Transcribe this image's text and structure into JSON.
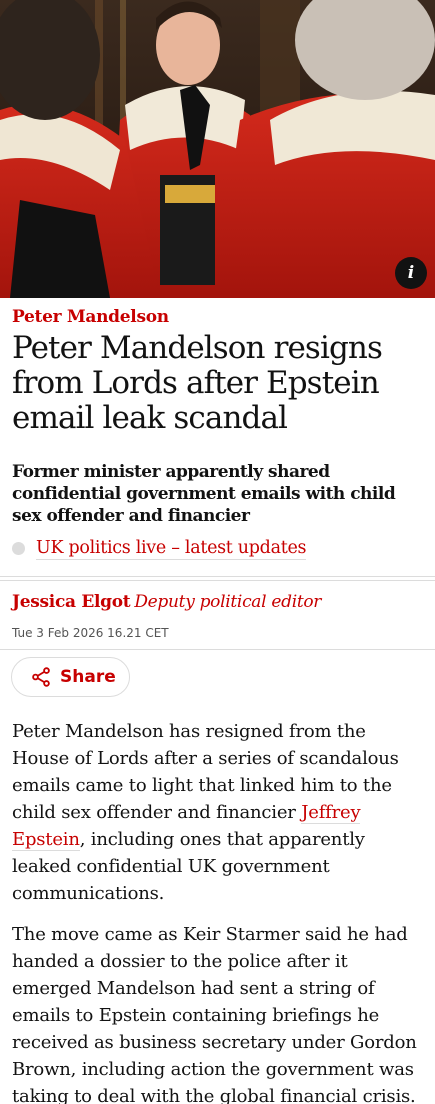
{
  "hero": {
    "info_label": "i"
  },
  "article": {
    "kicker": "Peter Mandelson",
    "headline": "Peter Mandelson resigns from Lords after Epstein email leak scandal",
    "standfirst": "Former minister apparently shared confidential government emails with child sex offender and financier",
    "live_link": "UK politics live – latest updates",
    "byline": {
      "name": "Jessica Elgot",
      "role": "Deputy political editor"
    },
    "dateline": "Tue 3 Feb 2026 16.21 CET",
    "share_label": "Share",
    "body": {
      "p1_before": "Peter Mandelson has resigned from the House of Lords after a series of scandalous emails came to light that linked him to the child sex offender and financier ",
      "p1_link": "Jeffrey Epstein",
      "p1_after": ", including ones that apparently leaked confidential UK government communications.",
      "p2": "The move came as Keir Starmer said he had handed a dossier to the police after it emerged Mandelson had sent a string of emails to Epstein containing briefings he received as business secretary under Gordon Brown, including action the government was taking to deal with the global financial crisis."
    }
  },
  "colors": {
    "accent": "#c70000",
    "text": "#121212",
    "divider": "#dcdcdc",
    "muted": "#545454"
  }
}
